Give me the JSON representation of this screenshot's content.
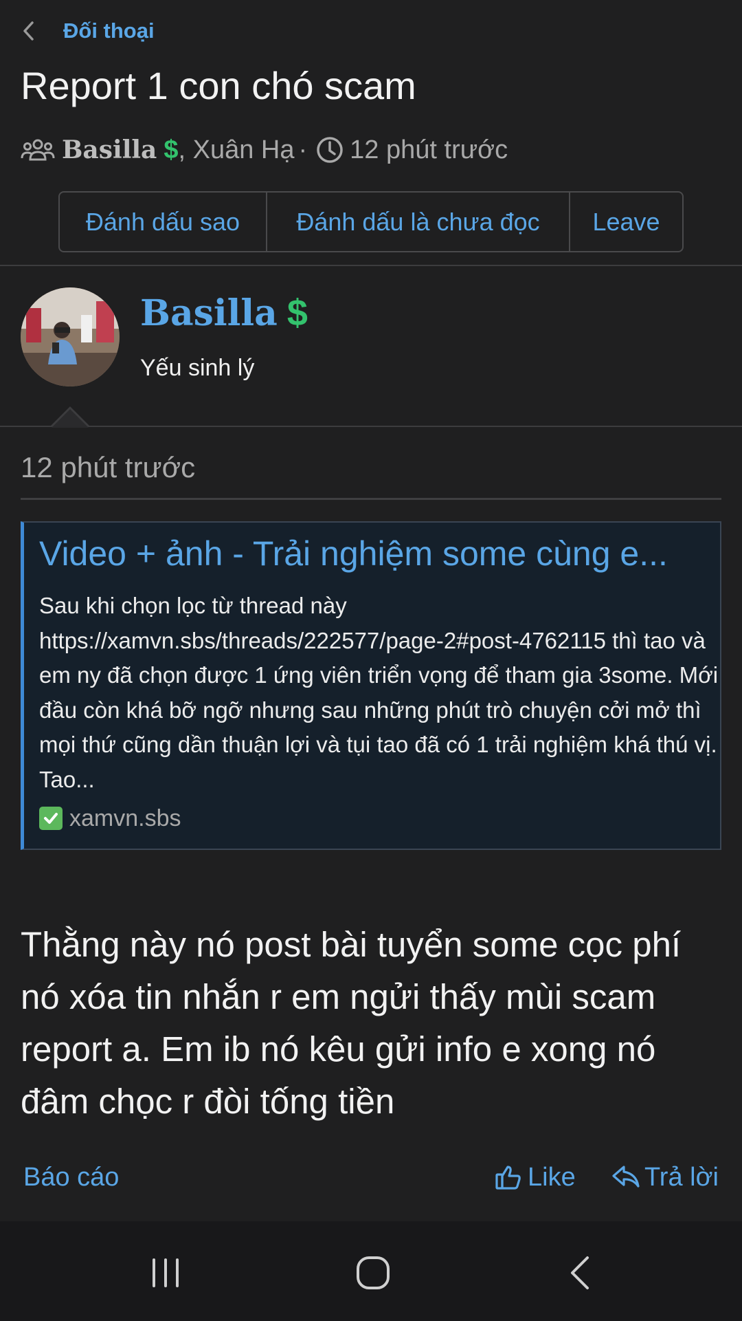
{
  "breadcrumb": {
    "label": "Đối thoại",
    "back_icon": "chevron-left-icon"
  },
  "thread": {
    "title": "Report 1 con chó scam",
    "participants_icon": "users-icon",
    "starter_name": "Basilla",
    "starter_badge": "$",
    "other_participant": ", Xuân Hạ",
    "separator": "·",
    "clock_icon": "clock-icon",
    "time": "12 phút trước"
  },
  "buttons": {
    "star": "Đánh dấu sao",
    "mark_unread": "Đánh dấu là chưa đọc",
    "leave": "Leave"
  },
  "message": {
    "author": "Basilla",
    "author_badge": "$",
    "user_title": "Yếu sinh lý",
    "time": "12 phút trước",
    "preview": {
      "title": "Video + ảnh - Trải nghiệm some cùng e...",
      "description": "Sau khi chọn lọc từ thread này https://xamvn.sbs/threads/222577/page-2#post-4762115 thì tao và em ny đã chọn được 1 ứng viên triển vọng để tham gia 3some. Mới đầu còn khá bỡ ngỡ nhưng sau những phút trò chuyện cởi mở thì mọi thứ cũng dần thuận lợi và tụi tao đã có 1 trải nghiệm khá thú vị. Tao...",
      "domain": "xamvn.sbs",
      "domain_icon": "check-box-icon"
    },
    "body": "Thằng này nó post bài tuyển some cọc phí nó xóa tin nhắn r em ngửi thấy mùi scam report a. Em ib nó kêu gửi info e xong nó đâm chọc r đòi tống tiền"
  },
  "actions": {
    "report": "Báo cáo",
    "like": "Like",
    "reply": "Trả lời"
  },
  "colors": {
    "background": "#1f1f20",
    "link": "#5aa6e6",
    "badge": "#33c26d",
    "preview_bg": "#15202b"
  }
}
